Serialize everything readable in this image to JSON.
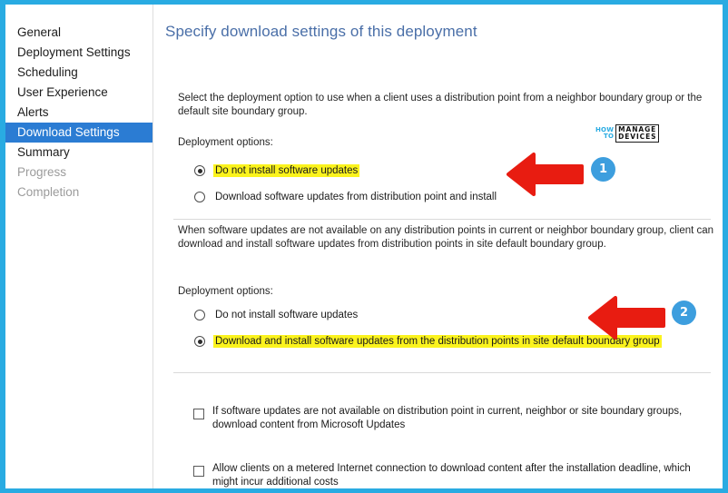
{
  "window": {
    "title": "Specify download settings of this deployment",
    "frame_color": "#29abe2"
  },
  "sidebar": {
    "items": [
      {
        "label": "General",
        "state": "normal"
      },
      {
        "label": "Deployment Settings",
        "state": "normal"
      },
      {
        "label": "Scheduling",
        "state": "normal"
      },
      {
        "label": "User Experience",
        "state": "normal"
      },
      {
        "label": "Alerts",
        "state": "normal"
      },
      {
        "label": "Download Settings",
        "state": "selected"
      },
      {
        "label": "Summary",
        "state": "normal"
      },
      {
        "label": "Progress",
        "state": "disabled"
      },
      {
        "label": "Completion",
        "state": "disabled"
      }
    ],
    "selected_bg": "#2b7cd3",
    "selected_fg": "#ffffff",
    "disabled_fg": "#9b9b9b"
  },
  "main": {
    "title": "Specify download settings of this deployment",
    "title_color": "#4a6fa8",
    "section_1": {
      "description": "Select the deployment option to use when a client uses a distribution point from a neighbor boundary group or the default site boundary group.",
      "group_label": "Deployment options:",
      "options": [
        {
          "label": "Do not install software updates",
          "checked": true,
          "highlighted": true
        },
        {
          "label": "Download software updates from distribution point and install",
          "checked": false,
          "highlighted": false
        }
      ]
    },
    "section_2": {
      "description": "When software updates are not available on any distribution points in current or neighbor boundary group, client can download and install software updates from distribution points in site default boundary group.",
      "group_label": "Deployment options:",
      "options": [
        {
          "label": "Do not install software updates",
          "checked": false,
          "highlighted": false
        },
        {
          "label": "Download and install software updates from the distribution points in site default boundary group",
          "checked": true,
          "highlighted": true
        }
      ]
    },
    "section_3": {
      "checkboxes": [
        {
          "label": "If software updates are not available on distribution point in current, neighbor or site boundary groups, download content from Microsoft Updates",
          "checked": false
        },
        {
          "label": "Allow clients on a metered Internet connection to download content after the installation deadline, which might incur additional costs",
          "checked": false
        }
      ]
    },
    "highlight_color": "#fbf31d"
  },
  "watermark": {
    "line_how": "HOW",
    "line_to": "TO",
    "line_manage": "MANAGE",
    "line_devices": "DEVICES",
    "accent_color": "#29abe2"
  },
  "annotations": {
    "arrow_color": "#e81c11",
    "badge_color": "#3d9ede",
    "badges": [
      {
        "number": "1"
      },
      {
        "number": "2"
      }
    ]
  }
}
